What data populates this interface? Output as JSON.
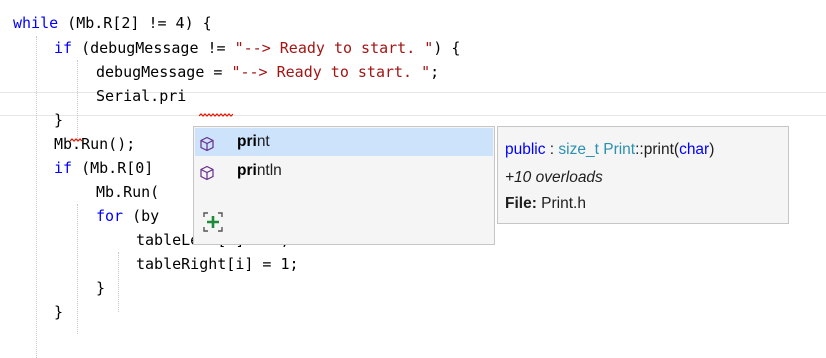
{
  "code": {
    "lines": [
      [
        {
          "c": "kw",
          "t": "while"
        },
        {
          "c": "op",
          "t": " (Mb.R[2] != 4) {"
        }
      ],
      [
        {
          "c": "kw",
          "t": "if"
        },
        {
          "c": "op",
          "t": " (debugMessage != "
        },
        {
          "c": "str",
          "t": "\"--> Ready to start. \""
        },
        {
          "c": "op",
          "t": ") {"
        }
      ],
      [
        {
          "c": "op",
          "t": "debugMessage = "
        },
        {
          "c": "str",
          "t": "\"--> Ready to start. \""
        },
        {
          "c": "op",
          "t": ";"
        }
      ],
      [
        {
          "c": "op",
          "t": "Serial.pri"
        }
      ],
      [
        {
          "c": "op",
          "t": "}"
        }
      ],
      [
        {
          "c": "op",
          "t": "Mb.Run();"
        }
      ],
      [
        {
          "c": "kw",
          "t": "if"
        },
        {
          "c": "op",
          "t": " (Mb.R[0]"
        }
      ],
      [
        {
          "c": "op",
          "t": "Mb.Run("
        }
      ],
      [
        {
          "c": "kw",
          "t": "for"
        },
        {
          "c": "op",
          "t": " (by"
        }
      ],
      [
        {
          "c": "op",
          "t": "tableLeft[i] = 0;"
        }
      ],
      [
        {
          "c": "op",
          "t": "tableRight[i] = 1;"
        }
      ],
      [
        {
          "c": "op",
          "t": "}"
        }
      ],
      [
        {
          "c": "op",
          "t": "}"
        }
      ]
    ]
  },
  "completion": {
    "items": [
      {
        "bold": "pri",
        "rest": "nt",
        "icon": "method-cube-icon",
        "selected": true
      },
      {
        "bold": "pri",
        "rest": "ntln",
        "icon": "method-cube-icon",
        "selected": false
      }
    ],
    "filter_icon": "expand-filter-icon"
  },
  "info": {
    "sig_public": "public",
    "sig_colon": " : ",
    "sig_type": "size_t",
    "sig_space": " ",
    "sig_class": "Print",
    "sig_sep": "::",
    "sig_fn": "print",
    "sig_paren_open": "(",
    "sig_param": "char",
    "sig_paren_close": ")",
    "overloads": "+10 overloads",
    "file_label": "File:",
    "file_name": " Print.h"
  },
  "colors": {
    "selection": "#cde3fb",
    "popup_bg": "#f5f5f5",
    "keyword": "#0000ff",
    "string": "#a31515"
  }
}
